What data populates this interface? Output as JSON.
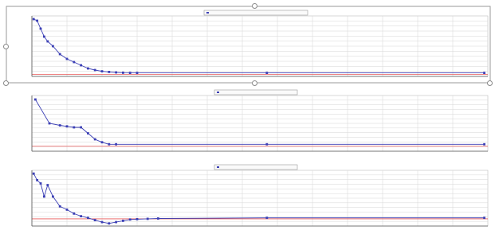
{
  "colors": {
    "series": "#3b3fb5",
    "threshold": "#e85a5a",
    "grid": "#d6d6d6",
    "axis": "#555555",
    "text": "#444444",
    "selection_frame": "#9a9a9a"
  },
  "chart_data": [
    {
      "type": "line",
      "ylabel": "",
      "legend": {
        "placement": "top-center",
        "entries": []
      },
      "grid": true,
      "selected": true,
      "xlim": [
        0,
        13
      ],
      "ylim": [
        0,
        38
      ],
      "threshold": 1.3,
      "series": [
        {
          "name": "",
          "x": [
            0.05,
            0.15,
            0.25,
            0.35,
            0.45,
            0.6,
            0.8,
            1.0,
            1.2,
            1.4,
            1.6,
            1.8,
            2.0,
            2.2,
            2.4,
            2.6,
            2.8,
            3.0,
            6.7,
            12.9
          ],
          "y": [
            36,
            35,
            30,
            25,
            22,
            19,
            14,
            11,
            9,
            7,
            5,
            4,
            3.2,
            2.8,
            2.5,
            2.3,
            2.2,
            2.2,
            2.2,
            2.2
          ]
        }
      ]
    },
    {
      "type": "line",
      "ylabel": "",
      "legend": {
        "placement": "top-center",
        "entries": []
      },
      "grid": true,
      "selected": false,
      "xlim": [
        0,
        13
      ],
      "ylim": [
        0,
        28
      ],
      "threshold": 2.5,
      "series": [
        {
          "name": "",
          "x": [
            0.1,
            0.5,
            0.8,
            1.0,
            1.2,
            1.4,
            1.6,
            1.8,
            2.0,
            2.2,
            2.4,
            6.7,
            12.9
          ],
          "y": [
            26,
            14,
            13,
            12.5,
            12,
            12,
            9,
            6,
            4.5,
            3.5,
            3.5,
            3.5,
            3.5
          ]
        }
      ]
    },
    {
      "type": "line",
      "ylabel": "",
      "legend": {
        "placement": "top-center",
        "entries": []
      },
      "grid": true,
      "selected": false,
      "xlim": [
        0,
        13
      ],
      "ylim": [
        0,
        17
      ],
      "threshold": 2.2,
      "series": [
        {
          "name": "",
          "x": [
            0.05,
            0.15,
            0.25,
            0.35,
            0.45,
            0.6,
            0.8,
            1.0,
            1.2,
            1.4,
            1.6,
            1.8,
            2.0,
            2.2,
            2.4,
            2.6,
            2.8,
            3.0,
            3.3,
            3.6,
            6.7,
            12.9
          ],
          "y": [
            16,
            14,
            13,
            9,
            12.5,
            9,
            6,
            5,
            3.8,
            3,
            2.5,
            1.8,
            1.2,
            0.8,
            1.2,
            1.6,
            2,
            2.1,
            2.2,
            2.3,
            2.5,
            2.5
          ]
        }
      ]
    }
  ]
}
